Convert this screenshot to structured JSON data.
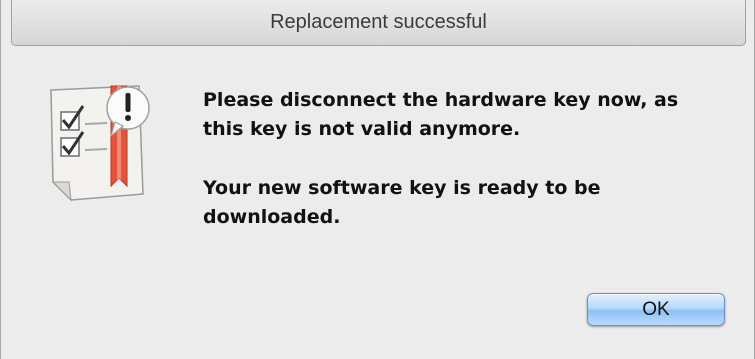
{
  "window": {
    "title": "Replacement successful"
  },
  "message": {
    "line1": "Please disconnect the hardware key now, as\nthis key is not valid anymore.",
    "line2": "Your new software key is ready to be\ndownloaded."
  },
  "buttons": {
    "ok_label": "OK"
  },
  "icon": {
    "name": "checklist-alert-icon",
    "accent_color": "#e5533b"
  }
}
